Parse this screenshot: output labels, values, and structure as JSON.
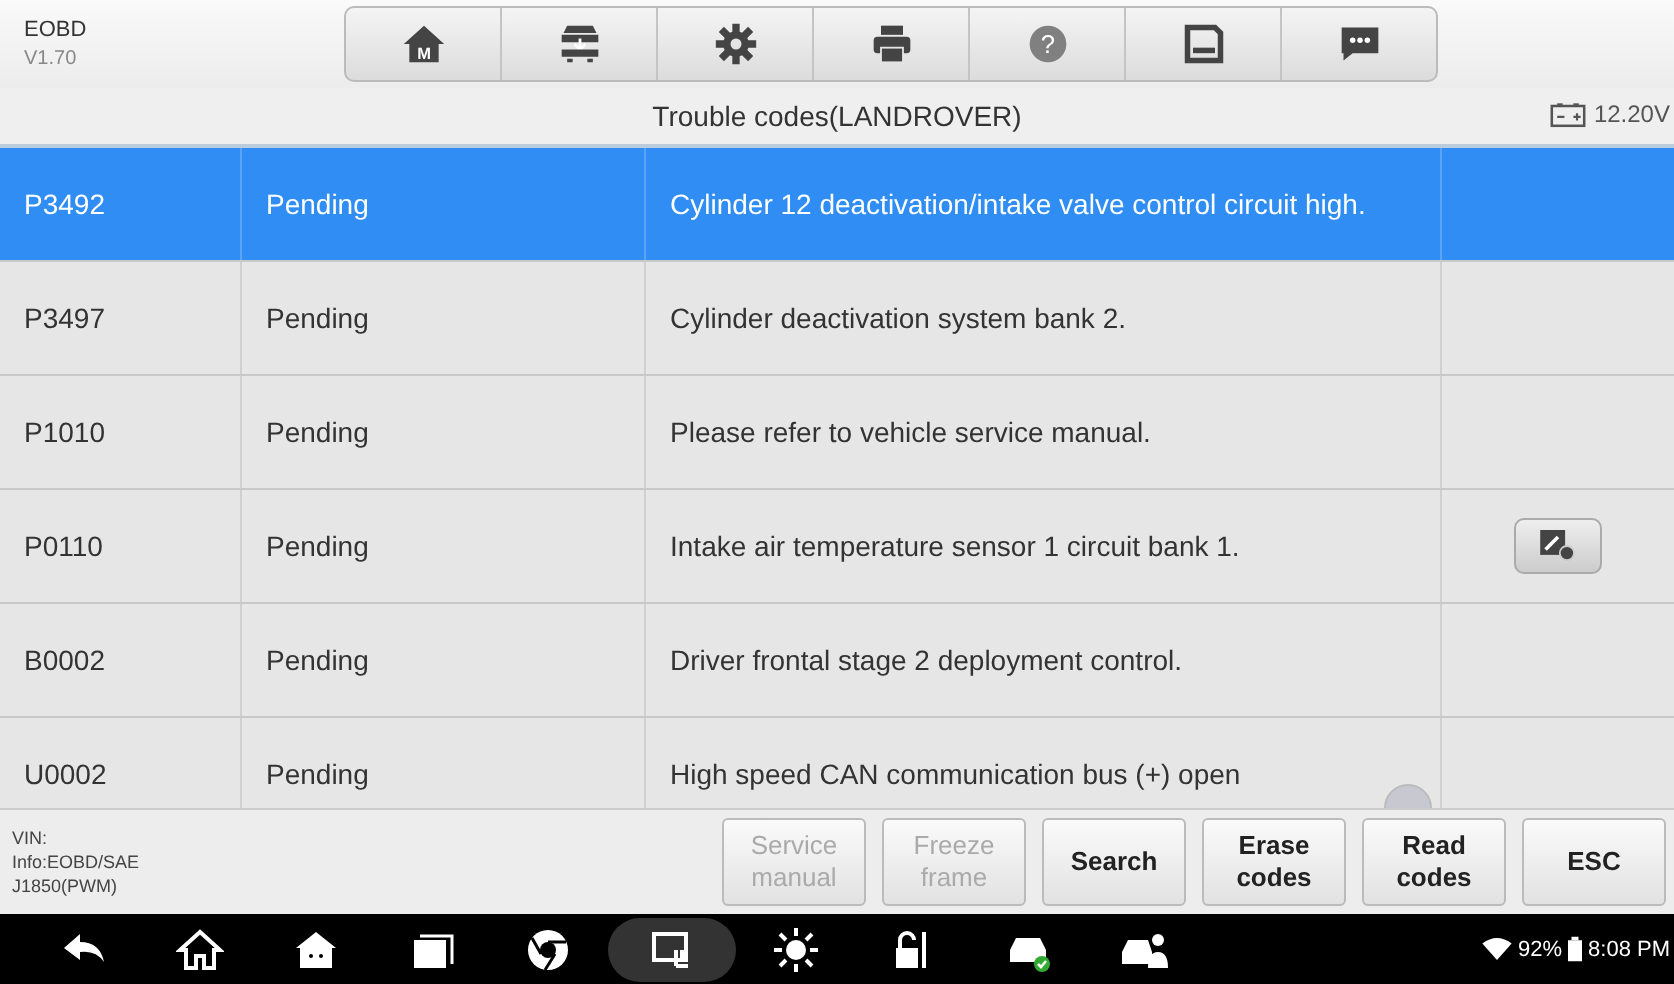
{
  "app": {
    "name": "EOBD",
    "version": "V1.70"
  },
  "toolbar": [
    {
      "kind": "home",
      "disabled": false,
      "glyph": "M"
    },
    {
      "kind": "vehicles",
      "disabled": false
    },
    {
      "kind": "settings",
      "disabled": false
    },
    {
      "kind": "print",
      "disabled": false
    },
    {
      "kind": "help",
      "disabled": true,
      "glyph": "?"
    },
    {
      "kind": "save",
      "disabled": false
    },
    {
      "kind": "messages",
      "disabled": false
    }
  ],
  "title_bar": {
    "title": "Trouble codes(LANDROVER)",
    "voltage": "12.20V"
  },
  "rows": [
    {
      "code": "P3492",
      "status": "Pending",
      "description": "Cylinder 12 deactivation/intake valve control circuit high.",
      "selected": true,
      "help_button": false
    },
    {
      "code": "P3497",
      "status": "Pending",
      "description": "Cylinder deactivation system bank 2.",
      "selected": false,
      "help_button": false
    },
    {
      "code": "P1010",
      "status": "Pending",
      "description": "Please refer to vehicle service manual.",
      "selected": false,
      "help_button": false
    },
    {
      "code": "P0110",
      "status": "Pending",
      "description": "Intake air temperature sensor 1 circuit bank 1.",
      "selected": false,
      "help_button": true
    },
    {
      "code": "B0002",
      "status": "Pending",
      "description": "Driver frontal stage 2 deployment control.",
      "selected": false,
      "help_button": false
    },
    {
      "code": "U0002",
      "status": "Pending",
      "description": "High speed CAN communication bus (+) open",
      "selected": false,
      "help_button": false
    }
  ],
  "footer": {
    "info": [
      "VIN:",
      "Info:EOBD/SAE",
      "J1850(PWM)"
    ],
    "buttons": [
      {
        "label": "Service manual",
        "disabled": true
      },
      {
        "label": "Freeze frame",
        "disabled": true
      },
      {
        "label": "Search",
        "disabled": false
      },
      {
        "label": "Erase codes",
        "disabled": false
      },
      {
        "label": "Read codes",
        "disabled": false
      },
      {
        "label": "ESC",
        "disabled": false
      }
    ]
  },
  "nav_bar": {
    "icons": [
      {
        "kind": "back",
        "selected": false
      },
      {
        "kind": "home",
        "selected": false
      },
      {
        "kind": "android",
        "selected": false
      },
      {
        "kind": "recents",
        "selected": false
      },
      {
        "kind": "browser",
        "selected": false
      },
      {
        "kind": "cast",
        "selected": true
      },
      {
        "kind": "brightness",
        "selected": false
      },
      {
        "kind": "lock",
        "selected": false
      },
      {
        "kind": "car-check",
        "selected": false
      },
      {
        "kind": "car-person",
        "selected": false
      }
    ],
    "battery": "92%",
    "time": "8:08 PM"
  }
}
